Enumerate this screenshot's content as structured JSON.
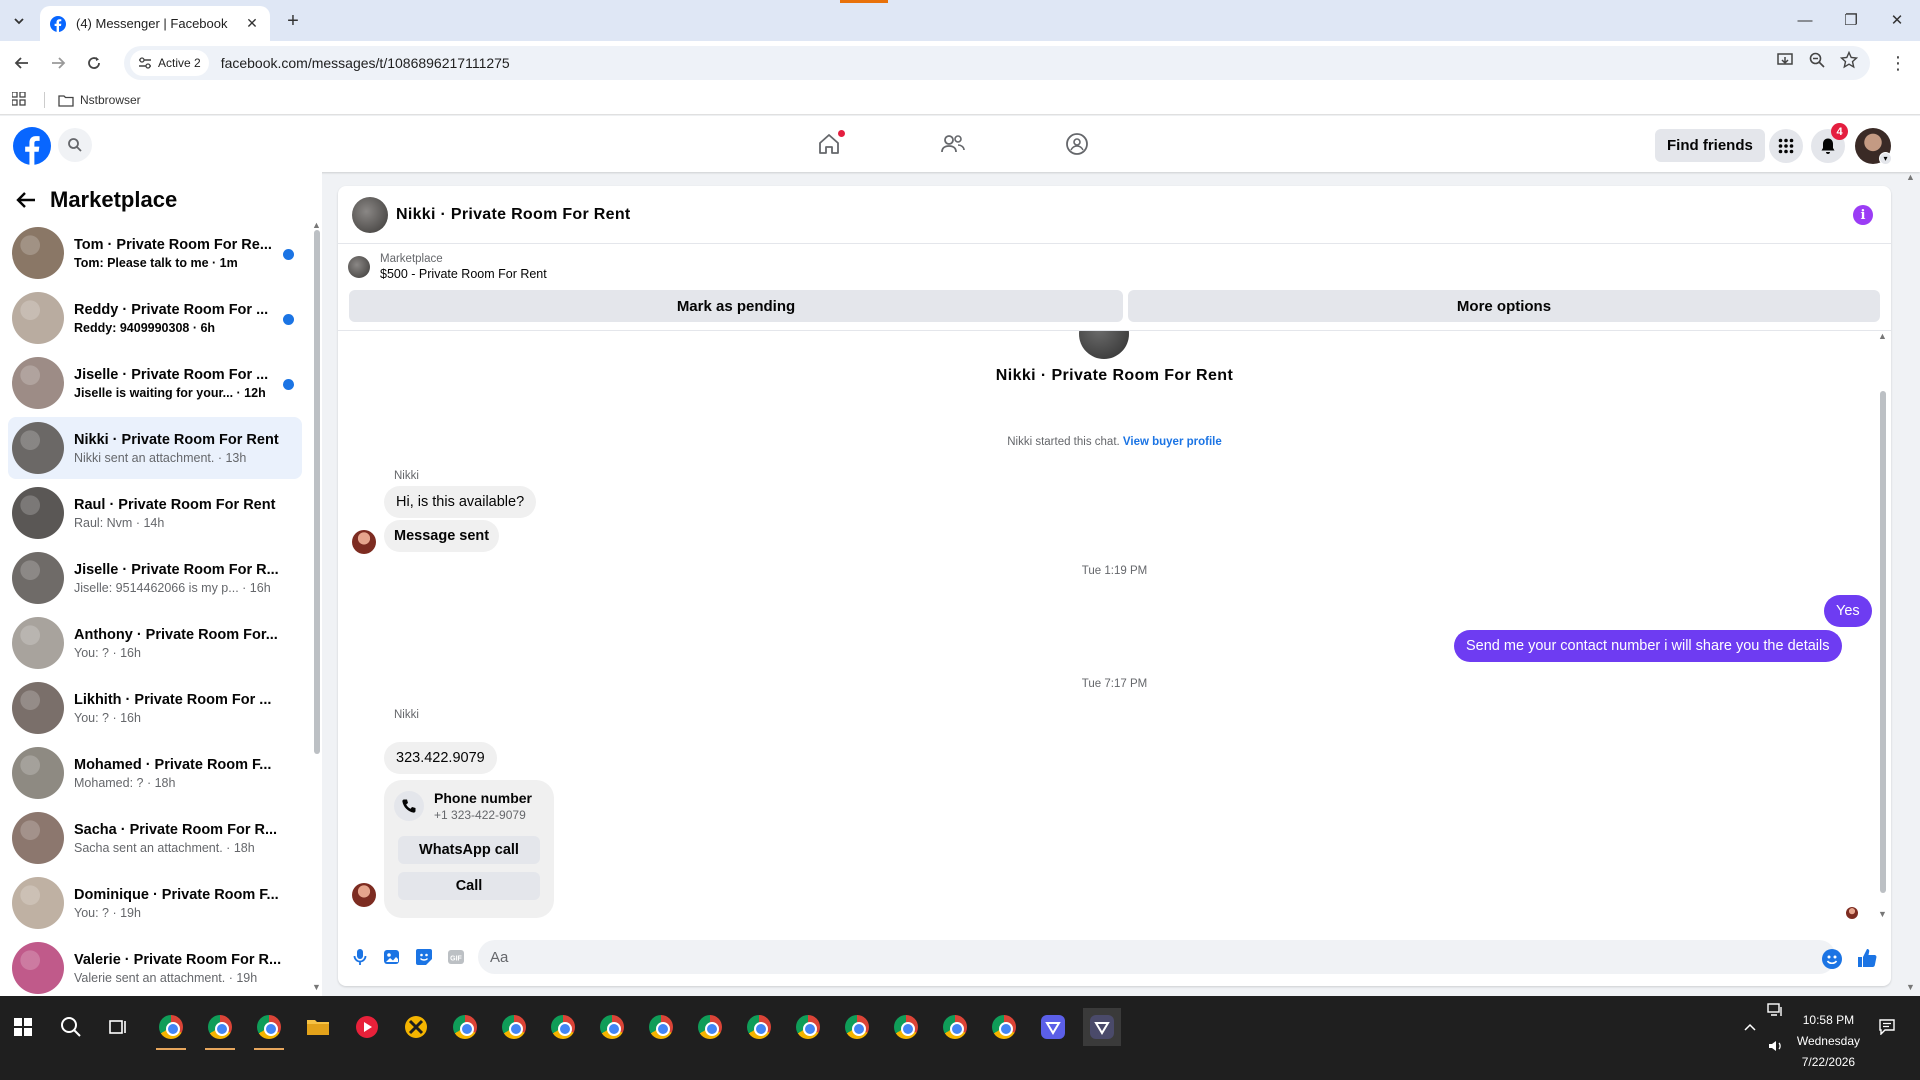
{
  "browser": {
    "tab_title": "(4) Messenger | Facebook",
    "site_chip": "Active 2",
    "url": "facebook.com/messages/t/1086896217111275",
    "bookmark": "Nstbrowser"
  },
  "fb_nav": {
    "find_friends": "Find friends",
    "notifications_count": "4"
  },
  "sidebar": {
    "title": "Marketplace",
    "conversations": [
      {
        "name": "Tom · Private Room For Re...",
        "snippet": "Tom: Please talk to me · 1m",
        "unread": true,
        "color": "#8a7766"
      },
      {
        "name": "Reddy · Private Room For ...",
        "snippet": "Reddy: 9409990308 · 6h",
        "unread": true,
        "color": "#b9aca0"
      },
      {
        "name": "Jiselle · Private Room For ...",
        "snippet": "Jiselle is waiting for your... · 12h",
        "unread": true,
        "color": "#9d8c86"
      },
      {
        "name": "Nikki · Private Room For Rent",
        "snippet": "Nikki sent an attachment. · 13h",
        "unread": false,
        "color": "#6b6866"
      },
      {
        "name": "Raul · Private Room For Rent",
        "snippet": "Raul: Nvm · 14h",
        "unread": false,
        "color": "#5a5755"
      },
      {
        "name": "Jiselle · Private Room For R...",
        "snippet": "Jiselle: 9514462066 is my p... · 16h",
        "unread": false,
        "color": "#6f6b68"
      },
      {
        "name": "Anthony · Private Room For...",
        "snippet": "You: ? · 16h",
        "unread": false,
        "color": "#a8a39d"
      },
      {
        "name": "Likhith · Private Room For ...",
        "snippet": "You: ? · 16h",
        "unread": false,
        "color": "#7a6f6a"
      },
      {
        "name": "Mohamed · Private Room F...",
        "snippet": "Mohamed: ? · 18h",
        "unread": false,
        "color": "#8e8a82"
      },
      {
        "name": "Sacha · Private Room For R...",
        "snippet": "Sacha sent an attachment. · 18h",
        "unread": false,
        "color": "#8c776e"
      },
      {
        "name": "Dominique · Private Room F...",
        "snippet": "You: ? · 19h",
        "unread": false,
        "color": "#bfb1a3"
      },
      {
        "name": "Valerie · Private Room For R...",
        "snippet": "Valerie sent an attachment. · 19h",
        "unread": false,
        "color": "#c05a8a"
      }
    ]
  },
  "chat": {
    "title": "Nikki · Private Room For Rent",
    "listing_label": "Marketplace",
    "listing_title": "$500 - Private Room For Rent",
    "mark_pending": "Mark as pending",
    "more_options": "More options",
    "center_name": "Nikki · Private Room For Rent",
    "started_text": "Nikki started this chat.",
    "view_profile": "View buyer profile",
    "sender_1": "Nikki",
    "msg_1": "Hi, is this available?",
    "msg_2": "Message sent",
    "ts_1": "Tue 1:19 PM",
    "msg_out_1": "Yes",
    "msg_out_2": "Send me your contact number i will share you the details",
    "ts_2": "Tue 7:17 PM",
    "sender_2": "Nikki",
    "msg_3": "323.422.9079",
    "card_title": "Phone number",
    "card_sub": "+1 323-422-9079",
    "whatsapp_call": "WhatsApp call",
    "call": "Call",
    "composer_placeholder": "Aa"
  },
  "taskbar": {
    "time": "10:58 PM",
    "day": "Wednesday",
    "date": "7/22/2026"
  },
  "colors": {
    "fb_blue": "#0866ff",
    "outgoing_bubble": "#6e3cf2",
    "unread_dot": "#1b74e4"
  }
}
